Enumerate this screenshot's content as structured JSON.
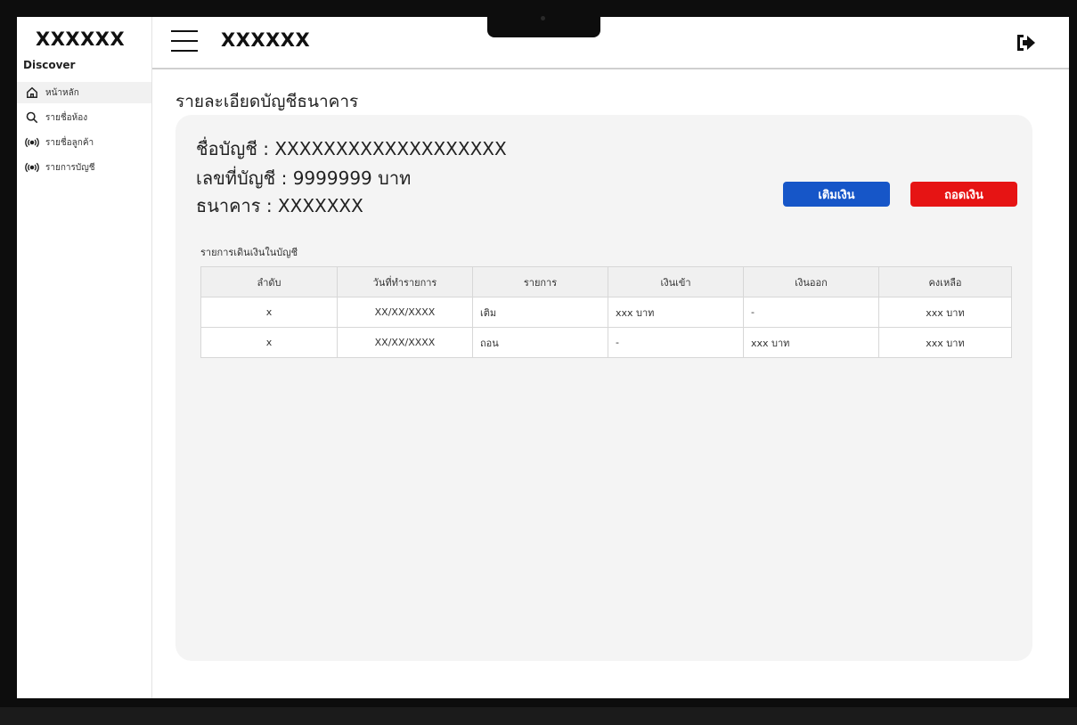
{
  "sidebar": {
    "brand": "XXXXXX",
    "section": "Discover",
    "items": [
      {
        "label": "หน้าหลัก",
        "icon": "home-icon"
      },
      {
        "label": "รายชื่อห้อง",
        "icon": "search-icon"
      },
      {
        "label": "รายชื่อลูกค้า",
        "icon": "broadcast-icon"
      },
      {
        "label": "รายการบัญชี",
        "icon": "broadcast-icon"
      }
    ]
  },
  "header": {
    "title": "XXXXXX",
    "logout_icon": "logout-icon"
  },
  "main": {
    "page_title": "รายละเอียดบัญชีธนาคาร",
    "account_name": "ชื่อบัญชี : XXXXXXXXXXXXXXXXXXX",
    "account_number": "เลขที่บัญชี : 9999999 บาท",
    "bank": "ธนาคาร : XXXXXXX",
    "deposit_label": "เติมเงิน",
    "withdraw_label": "ถอดเงิน",
    "table_caption": "รายการเดินเงินในบัญชี",
    "table": {
      "headers": [
        "ลำดับ",
        "วันที่ทำรายการ",
        "รายการ",
        "เงินเข้า",
        "เงินออก",
        "คงเหลือ"
      ],
      "rows": [
        [
          "x",
          "XX/XX/XXXX",
          "เติม",
          "xxx บาท",
          "-",
          "xxx บาท"
        ],
        [
          "x",
          "XX/XX/XXXX",
          "ถอน",
          "-",
          "xxx บาท",
          "xxx บาท"
        ]
      ]
    }
  },
  "colors": {
    "deposit": "#1656c8",
    "withdraw": "#e61414",
    "card_bg": "#f4f4f4"
  }
}
